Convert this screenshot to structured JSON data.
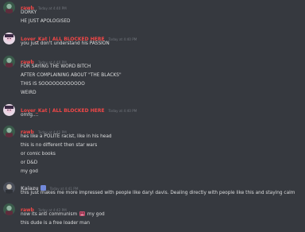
{
  "messages": [
    {
      "author": "rawb",
      "timestamp": "Today at 4:40 PM",
      "lines": [
        "DORKY",
        "HE JUST APOLOGISED"
      ]
    },
    {
      "author": "Lover_Kat | ALL BLOCKED HERE",
      "timestamp": "Today at 4:40 PM",
      "lines": [
        "you just don't understand his PASSION"
      ]
    },
    {
      "author": "rawb",
      "timestamp": "Today at 4:40 PM",
      "lines": [
        "FOR SAYING THE WORD BITCH",
        "AFTER COMPLAINING ABOUT \"THE BLACKS\"",
        "THIS IS SOOOOOOOOOOOO",
        "WEIRD"
      ]
    },
    {
      "author": "Lover_Kat | ALL BLOCKED HERE",
      "timestamp": "Today at 4:40 PM",
      "lines": [
        "omfg...."
      ]
    },
    {
      "author": "rawb",
      "timestamp": "Today at 4:41 PM",
      "lines": [
        "hes like a POLITE racist, like in his head",
        "this is no different then star wars",
        "or comic books",
        "or D&D",
        "my god"
      ]
    },
    {
      "author": "Kaiazu",
      "timestamp": "Today at 4:41 PM",
      "lines": [
        "this just makes me more impressed with people like daryl davis. Dealing directly with people like this and staying calm"
      ]
    },
    {
      "author": "rawb",
      "timestamp": "Today at 4:42 PM",
      "lines": [
        "now its anti communism",
        "my god",
        "this dude is a free loader man"
      ]
    }
  ],
  "icons": {
    "emoji": "angry-face-icon",
    "badge": "nitro-badge-icon"
  },
  "colors": {
    "background": "#36393f",
    "text": "#dcddde",
    "timestamp": "#72767d",
    "rawb": "#f04747",
    "lover_kat": "#f04747",
    "kaiazu": "#b0b0b5"
  }
}
